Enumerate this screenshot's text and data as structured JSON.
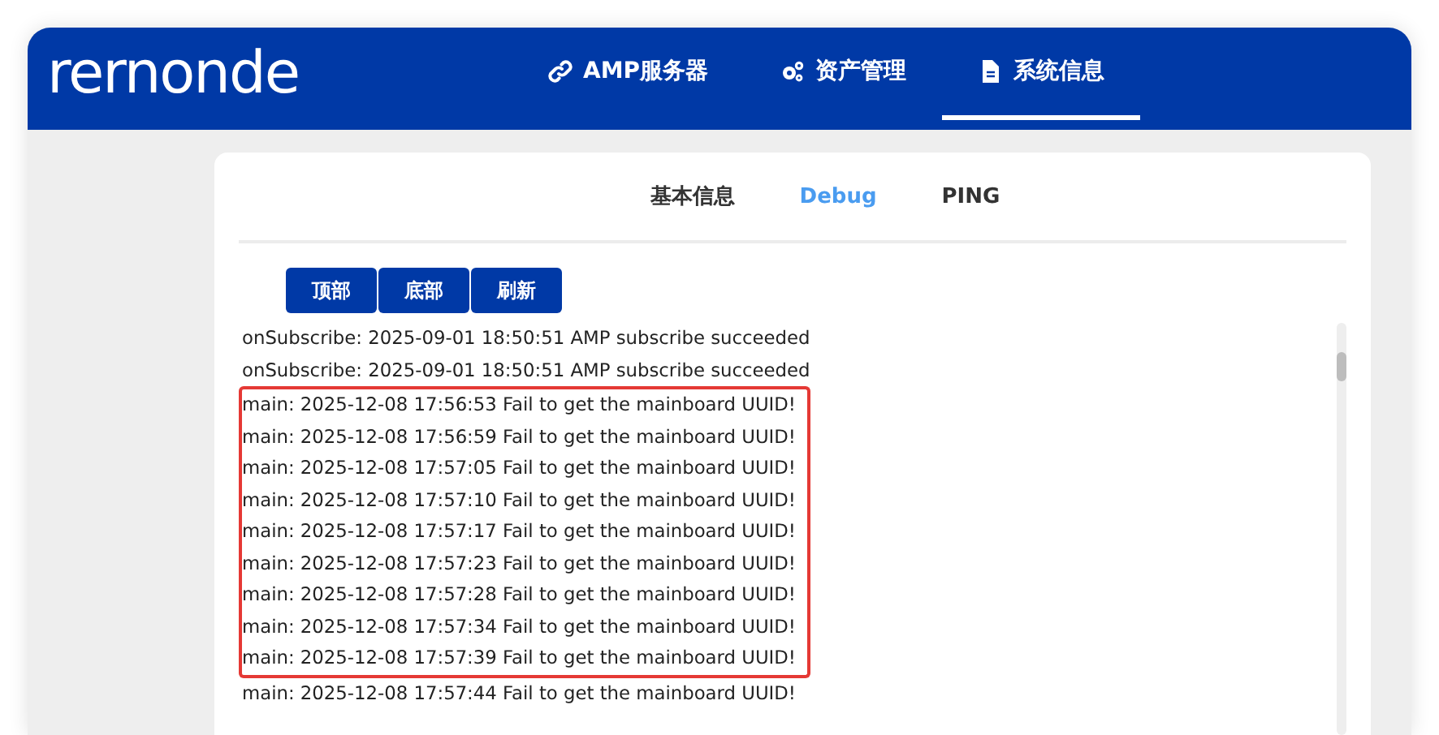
{
  "header": {
    "logo": "rernonde",
    "nav": [
      {
        "label": "AMP服务器",
        "selected": false
      },
      {
        "label": "资产管理",
        "selected": false
      },
      {
        "label": "系统信息",
        "selected": true
      }
    ]
  },
  "tabs": [
    {
      "label": "基本信息",
      "selected": false
    },
    {
      "label": "Debug",
      "selected": true
    },
    {
      "label": "PING",
      "selected": false
    }
  ],
  "buttons": [
    "顶部",
    "底部",
    "刷新"
  ],
  "log": [
    {
      "text": "onSubscribe: 2025-09-01 18:50:51 AMP subscribe succeeded",
      "highlighted": false
    },
    {
      "text": "onSubscribe: 2025-09-01 18:50:51 AMP subscribe succeeded",
      "highlighted": false
    },
    {
      "text": "main: 2025-12-08 17:56:53 Fail to get the mainboard UUID!",
      "highlighted": true
    },
    {
      "text": "main: 2025-12-08 17:56:59 Fail to get the mainboard UUID!",
      "highlighted": true
    },
    {
      "text": "main: 2025-12-08 17:57:05 Fail to get the mainboard UUID!",
      "highlighted": true
    },
    {
      "text": "main: 2025-12-08 17:57:10 Fail to get the mainboard UUID!",
      "highlighted": true
    },
    {
      "text": "main: 2025-12-08 17:57:17 Fail to get the mainboard UUID!",
      "highlighted": true
    },
    {
      "text": "main: 2025-12-08 17:57:23 Fail to get the mainboard UUID!",
      "highlighted": true
    },
    {
      "text": "main: 2025-12-08 17:57:28 Fail to get the mainboard UUID!",
      "highlighted": true
    },
    {
      "text": "main: 2025-12-08 17:57:34 Fail to get the mainboard UUID!",
      "highlighted": true
    },
    {
      "text": "main: 2025-12-08 17:57:39 Fail to get the mainboard UUID!",
      "highlighted": true
    },
    {
      "text": "main: 2025-12-08 17:57:44 Fail to get the mainboard UUID!",
      "highlighted": false
    }
  ]
}
